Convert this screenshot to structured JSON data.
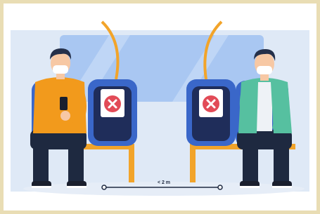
{
  "scene": {
    "distance_label": "< 2 m"
  },
  "colors": {
    "frame_border": "#e9ddb4",
    "wall_blue": "#dfe9f6",
    "window_blue": "#a9c7f2",
    "seat_blue": "#3a67c9",
    "seat_dark": "#1f2d5a",
    "rail_orange": "#f2a42a",
    "sign_red": "#e24b57",
    "shirt_orange": "#f29a1c",
    "shirt_green": "#56c0a0",
    "pants_navy": "#1e2940",
    "skin": "#f7c8a4",
    "hair": "#25304a",
    "mask": "#ffffff"
  },
  "icons": [
    "x-sign-icon",
    "phone-icon",
    "face-mask-icon"
  ]
}
